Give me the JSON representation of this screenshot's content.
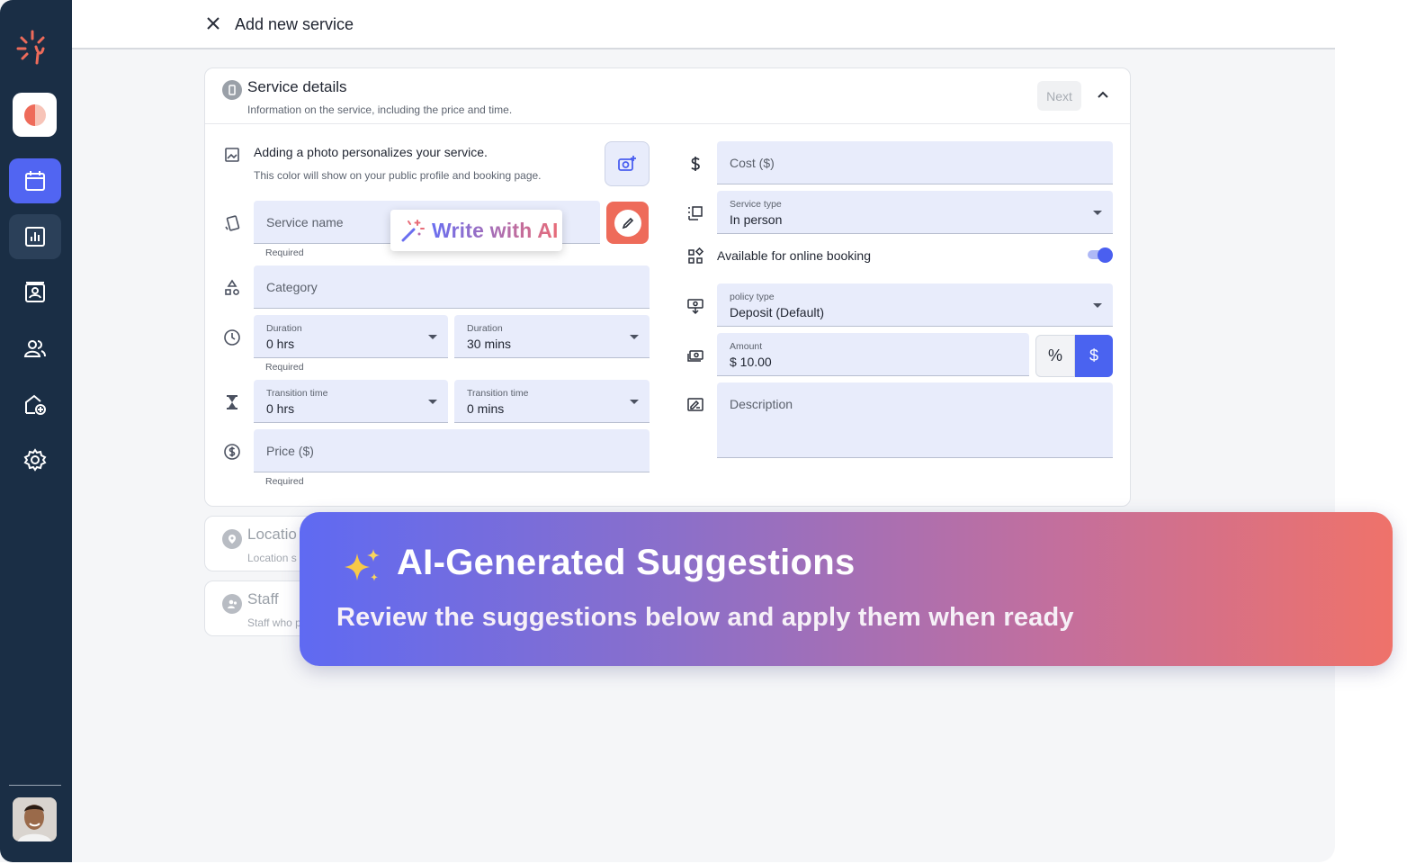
{
  "header": {
    "title": "Add new service"
  },
  "service_details": {
    "title": "Service details",
    "subtitle": "Information on the service, including the price and time.",
    "next_label": "Next",
    "photo": {
      "title": "Adding a photo personalizes your service.",
      "subtitle": "This color will show on your public profile and booking page."
    },
    "service_name": {
      "placeholder": "Service name",
      "helper": "Required"
    },
    "write_with_ai": "Write with AI",
    "category": {
      "placeholder": "Category"
    },
    "duration_hrs": {
      "label": "Duration",
      "value": "0 hrs"
    },
    "duration_mins": {
      "label": "Duration",
      "value": "30 mins"
    },
    "duration_helper": "Required",
    "transition_hrs": {
      "label": "Transition time",
      "value": "0 hrs"
    },
    "transition_mins": {
      "label": "Transition time",
      "value": "0 mins"
    },
    "price": {
      "placeholder": "Price ($)",
      "helper": "Required"
    },
    "cost": {
      "placeholder": "Cost ($)"
    },
    "service_type": {
      "label": "Service type",
      "value": "In person"
    },
    "online_booking": {
      "label": "Available for online booking",
      "enabled": true
    },
    "policy_type": {
      "label": "policy type",
      "value": "Deposit (Default)"
    },
    "amount": {
      "label": "Amount",
      "value": "$ 10.00"
    },
    "percent_symbol": "%",
    "dollar_symbol": "$",
    "description": {
      "placeholder": "Description"
    }
  },
  "location_section": {
    "title": "Locatio",
    "subtitle": "Location s"
  },
  "staff_section": {
    "title": "Staff",
    "subtitle": "Staff who p"
  },
  "banner": {
    "title": "AI-Generated Suggestions",
    "subtitle": "Review the suggestions below and apply them when ready"
  },
  "colors": {
    "sidebar": "#1a2e45",
    "accent": "#5165f2",
    "field_bg": "#e8ecfb",
    "edit_button": "#ee6b5a"
  },
  "icons": {
    "sidebar": [
      "logo-icon",
      "business-icon",
      "calendar-icon",
      "reports-icon",
      "clients-icon",
      "staff-icon",
      "locations-icon",
      "settings-icon"
    ],
    "form": [
      "image-icon",
      "service-name-icon",
      "category-icon",
      "clock-icon",
      "hourglass-icon",
      "price-icon",
      "dollar-icon",
      "service-type-icon",
      "online-booking-icon",
      "policy-icon",
      "amount-icon",
      "description-icon"
    ]
  }
}
